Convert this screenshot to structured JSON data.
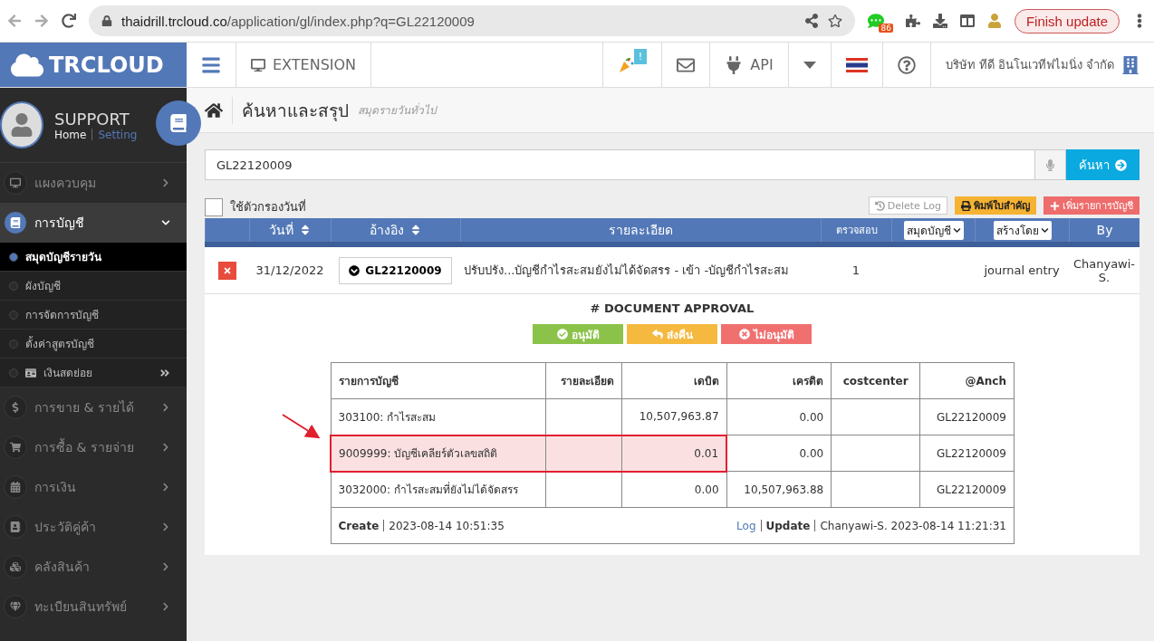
{
  "browser": {
    "url_host": "thaidrill.trcloud.co",
    "url_path": "/application/gl/index.php?q=GL22120009",
    "extension_badge": "86",
    "update_button": "Finish update"
  },
  "header": {
    "logo": "TRCLOUD",
    "extension": "EXTENSION",
    "notice_badge": "!",
    "api": "API",
    "company": "บริษัท ทีดี อินโนเวทีฟไมนิ่ง จำกัด"
  },
  "user": {
    "name": "SUPPORT",
    "home": "Home",
    "setting": "Setting"
  },
  "sidebar": {
    "items": [
      {
        "label": "แผงควบคุม",
        "expanded": false
      },
      {
        "label": "การบัญชี",
        "expanded": true,
        "children": [
          {
            "label": "สมุดบัญชีรายวัน",
            "selected": true,
            "kind": "plain"
          },
          {
            "label": "ผังบัญชี",
            "selected": false,
            "kind": "plain"
          },
          {
            "label": "การจัดการบัญชี",
            "selected": false,
            "kind": "plain"
          },
          {
            "label": "ตั้งค่าสูตรบัญชี",
            "selected": false,
            "kind": "plain"
          },
          {
            "label": "เงินสดย่อย",
            "selected": false,
            "kind": "submenu"
          }
        ]
      },
      {
        "label": "การขาย & รายได้",
        "expanded": false
      },
      {
        "label": "การซื้อ & รายจ่าย",
        "expanded": false
      },
      {
        "label": "การเงิน",
        "expanded": false
      },
      {
        "label": "ประวัติคู่ค้า",
        "expanded": false
      },
      {
        "label": "คลังสินค้า",
        "expanded": false
      },
      {
        "label": "ทะเบียนสินทรัพย์",
        "expanded": false
      }
    ]
  },
  "page": {
    "title": "ค้นหาและสรุป",
    "subtitle": "สมุดรายวันทั่วไป"
  },
  "search": {
    "value": "GL22120009",
    "button": "ค้นหา"
  },
  "filter": {
    "label": "ใช้ตัวกรองวันที่",
    "checked": false
  },
  "actions": [
    {
      "label": "Delete Log",
      "kind": "log"
    },
    {
      "label": "พิมพ์ใบสำคัญ",
      "kind": "print"
    },
    {
      "label": "เพิ่มรายการบัญชี",
      "kind": "add"
    }
  ],
  "journal_table": {
    "columns": [
      {
        "kind": "blank"
      },
      {
        "label": "วันที่",
        "kind": "sort"
      },
      {
        "label": "อ้างอิง",
        "kind": "sort"
      },
      {
        "label": "รายละเอียด",
        "kind": "plain"
      },
      {
        "label": "ตรวจสอบ",
        "kind": "small"
      },
      {
        "label": "สมุดบัญชี",
        "kind": "select"
      },
      {
        "label": "สร้างโดย",
        "kind": "select"
      },
      {
        "label": "By",
        "kind": "plain"
      }
    ],
    "rows": [
      {
        "date": "31/12/2022",
        "reference": "GL22120009",
        "detail": "ปรับปรัง...บัญชีกำไรสะสมยังไม่ได้จัดสรร - เข้า -บัญชีกำไรสะสม",
        "check": "1",
        "type": "journal entry",
        "by": "Chanyawi-S."
      }
    ]
  },
  "approval": {
    "title": "# DOCUMENT APPROVAL",
    "buttons": [
      {
        "label": "อนุมัติ",
        "kind": "approve"
      },
      {
        "label": "ส่งคืน",
        "kind": "return"
      },
      {
        "label": "ไม่อนุมัติ",
        "kind": "reject"
      }
    ]
  },
  "entries_table": {
    "columns": [
      "รายการบัญชี",
      "รายละเอียด",
      "เดบิต",
      "เครดิต",
      "costcenter",
      "@Anch"
    ],
    "rows": [
      {
        "cells": [
          "303100: กำไรสะสม",
          "",
          "10,507,963.87",
          "0.00",
          "",
          "GL22120009"
        ],
        "highlighted": false
      },
      {
        "cells": [
          "9009999: บัญชีเคลียร์ตัวเลขสถิติ",
          "",
          "0.01",
          "0.00",
          "",
          "GL22120009"
        ],
        "highlighted": true
      },
      {
        "cells": [
          "3032000: กำไรสะสมที่ยังไม่ได้จัดสรร",
          "",
          "0.00",
          "10,507,963.88",
          "",
          "GL22120009"
        ],
        "highlighted": false
      }
    ],
    "footer": {
      "create_label": "Create",
      "create_time": "2023-08-14 10:51:35",
      "log": "Log",
      "update_label": "Update",
      "update_info": "Chanyawi-S. 2023-08-14 11:21:31"
    }
  }
}
